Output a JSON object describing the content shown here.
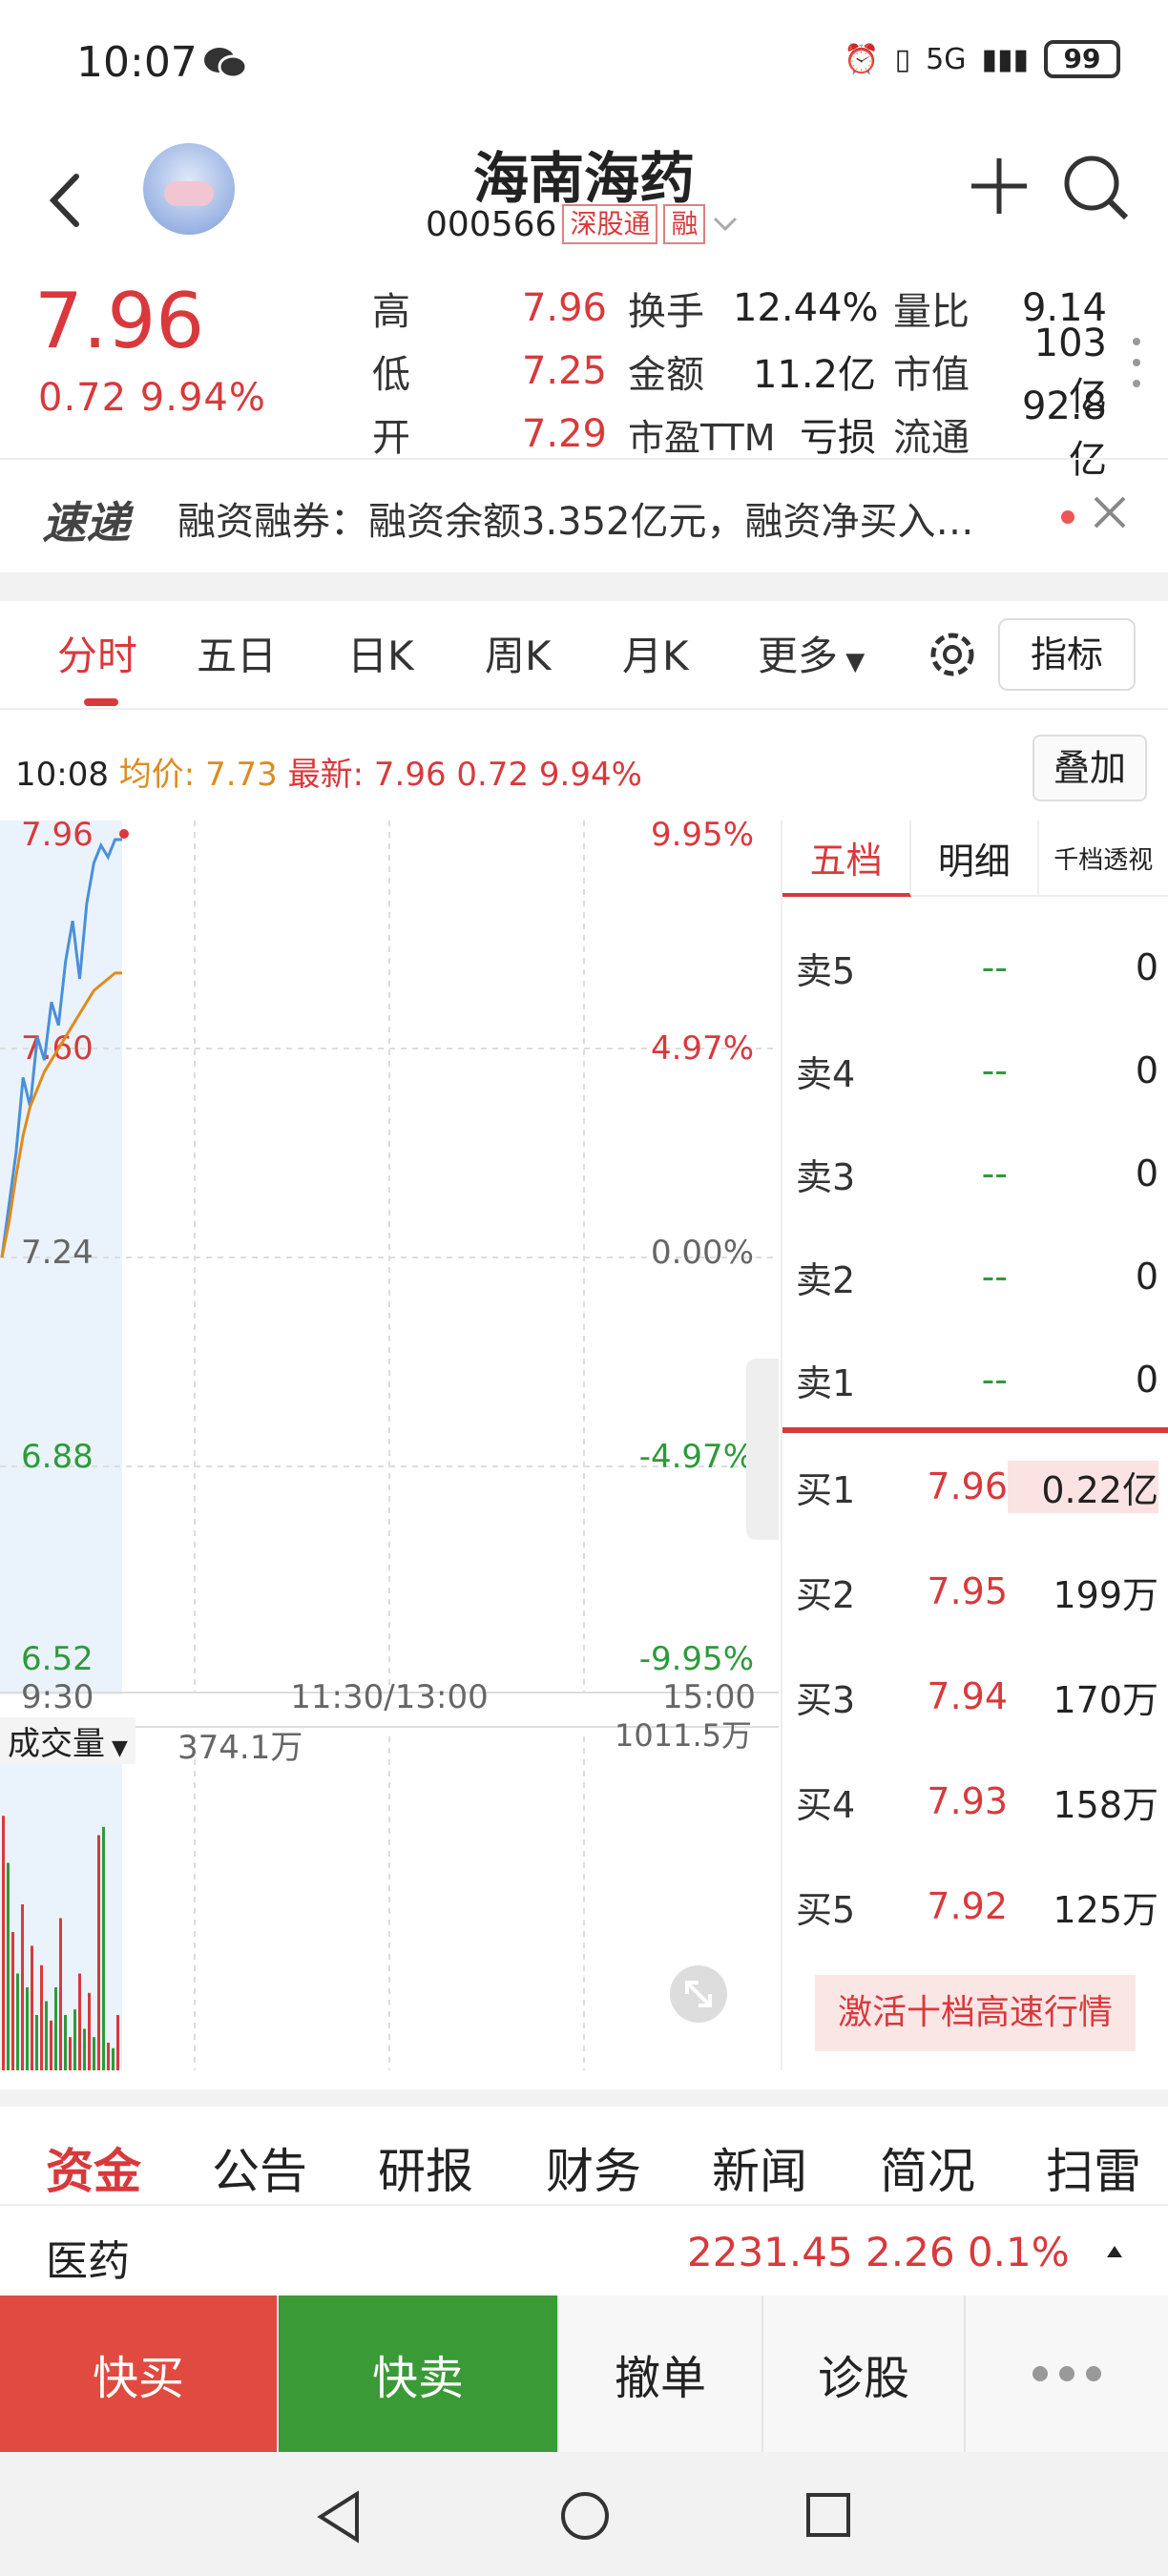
{
  "status_bar": {
    "time": "10:07",
    "network": "5G",
    "battery": "99"
  },
  "header": {
    "title": "海南海药",
    "code": "000566",
    "tag_exchange": "深股通",
    "tag_margin": "融"
  },
  "quote": {
    "price": "7.96",
    "change": "0.72",
    "change_pct": "9.94%",
    "stats": [
      {
        "l1": "高",
        "v1": "7.96",
        "l2": "换手",
        "v2": "12.44%",
        "l3": "量比",
        "v3": "9.14"
      },
      {
        "l1": "低",
        "v1": "7.25",
        "l2": "金额",
        "v2": "11.2亿",
        "l3": "市值",
        "v3": "103亿"
      },
      {
        "l1": "开",
        "v1": "7.29",
        "l2": "市盈TTM",
        "v2": "亏损",
        "l3": "流通",
        "v3": "92.8亿"
      }
    ]
  },
  "news": {
    "badge": "速递",
    "text": "融资融券：融资余额3.352亿元，融资净买入…"
  },
  "tabs": [
    "分时",
    "五日",
    "日K",
    "周K",
    "月K",
    "更多"
  ],
  "indicator_btn": "指标",
  "chart_info": {
    "time": "10:08",
    "avg_label": "均价:",
    "avg": "7.73",
    "latest_label": "最新:",
    "latest": "7.96 0.72 9.94%",
    "overlay_btn": "叠加"
  },
  "chart_data": {
    "type": "line",
    "price_axis": [
      "7.96",
      "7.60",
      "7.24",
      "6.88",
      "6.52"
    ],
    "pct_axis": [
      "9.95%",
      "4.97%",
      "0.00%",
      "-4.97%",
      "-9.95%"
    ],
    "time_axis": [
      "9:30",
      "11:30/13:00",
      "15:00"
    ],
    "volume_label": "成交量",
    "volume_value": "374.1万",
    "volume_max": "1011.5万",
    "series": [
      {
        "name": "price",
        "color": "#4a90d9",
        "values": [
          7.24,
          7.33,
          7.42,
          7.55,
          7.5,
          7.62,
          7.58,
          7.68,
          7.64,
          7.75,
          7.82,
          7.72,
          7.85,
          7.92,
          7.95,
          7.93,
          7.96,
          7.96
        ]
      },
      {
        "name": "avg",
        "color": "#e08a1e",
        "values": [
          7.24,
          7.3,
          7.38,
          7.45,
          7.5,
          7.53,
          7.56,
          7.58,
          7.6,
          7.62,
          7.64,
          7.66,
          7.68,
          7.7,
          7.71,
          7.72,
          7.73,
          7.73
        ]
      }
    ],
    "volumes": [
      0.92,
      0.75,
      0.5,
      0.35,
      0.6,
      0.3,
      0.45,
      0.2,
      0.38,
      0.25,
      0.18,
      0.3,
      0.55,
      0.2,
      0.12,
      0.22,
      0.35,
      0.15,
      0.28,
      0.12,
      0.85,
      0.88,
      0.1,
      0.08,
      0.2
    ]
  },
  "book": {
    "tabs": [
      "五档",
      "明细",
      "千档透视"
    ],
    "sells": [
      {
        "label": "卖5",
        "price": "--",
        "vol": "0"
      },
      {
        "label": "卖4",
        "price": "--",
        "vol": "0"
      },
      {
        "label": "卖3",
        "price": "--",
        "vol": "0"
      },
      {
        "label": "卖2",
        "price": "--",
        "vol": "0"
      },
      {
        "label": "卖1",
        "price": "--",
        "vol": "0"
      }
    ],
    "buys": [
      {
        "label": "买1",
        "price": "7.96",
        "vol": "0.22亿"
      },
      {
        "label": "买2",
        "price": "7.95",
        "vol": "199万"
      },
      {
        "label": "买3",
        "price": "7.94",
        "vol": "170万"
      },
      {
        "label": "买4",
        "price": "7.93",
        "vol": "158万"
      },
      {
        "label": "买5",
        "price": "7.92",
        "vol": "125万"
      }
    ],
    "activate": "激活十档高速行情"
  },
  "bottom_tabs": [
    "资金",
    "公告",
    "研报",
    "财务",
    "新闻",
    "简况",
    "扫雷"
  ],
  "sector": {
    "name": "医药",
    "values": "2231.45  2.26  0.1%"
  },
  "actions": [
    "快买",
    "快卖",
    "撤单",
    "诊股"
  ]
}
